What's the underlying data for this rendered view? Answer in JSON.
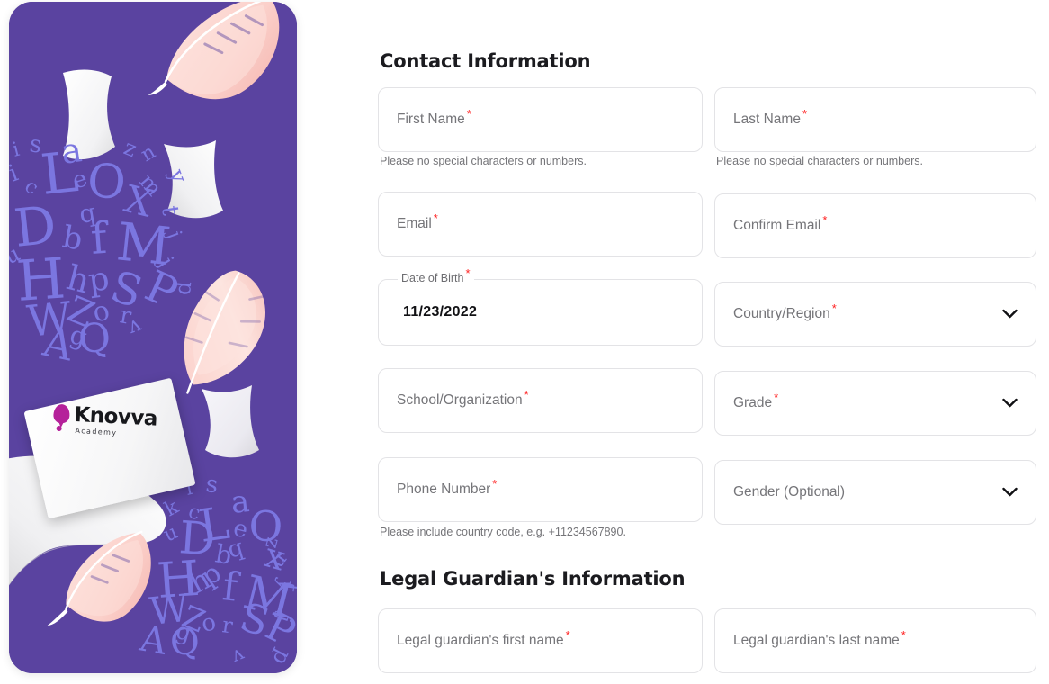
{
  "illustration": {
    "panel_color": "#5a43a0",
    "letters_color": "#7b76e0",
    "feather_color": "#fbd2cd",
    "paper_color": "#ffffff",
    "logo": {
      "name": "Knovva",
      "subtitle": "Academy",
      "mark": "balloon-bulb-icon",
      "mark_color": "#b5219a"
    },
    "scattered_letters": [
      "i",
      "s",
      "a",
      "z",
      "n",
      "y",
      "L",
      "e",
      "O",
      "x",
      "m",
      "t",
      "j",
      "c",
      "q",
      "X",
      "D",
      "b",
      "f",
      "M",
      "j",
      "u",
      "h",
      "p",
      "S",
      "P",
      "W",
      "z",
      "o",
      "r",
      "v",
      "g",
      "A",
      "Q",
      "k",
      "i",
      "s",
      "a",
      "L",
      "e",
      "O",
      "x",
      "n",
      "y",
      "D",
      "b",
      "f",
      "M",
      "H",
      "p",
      "S",
      "P",
      "t",
      "A",
      "Q",
      "r",
      "v",
      "p"
    ]
  },
  "form": {
    "sections": [
      {
        "title": "Contact Information",
        "rows": [
          {
            "left": {
              "label": "First Name",
              "required": true,
              "type": "text",
              "helper": "Please no special characters or numbers."
            },
            "right": {
              "label": "Last Name",
              "required": true,
              "type": "text",
              "helper": "Please no special characters or numbers."
            }
          },
          {
            "left": {
              "label": "Email",
              "required": true,
              "type": "text",
              "helper": ""
            },
            "right": {
              "label": "Confirm Email",
              "required": true,
              "type": "text",
              "helper": ""
            }
          },
          {
            "left": {
              "label": "Date of Birth",
              "required": true,
              "type": "date-filled",
              "value": "11/23/2022",
              "helper": ""
            },
            "right": {
              "label": "Country/Region",
              "required": true,
              "type": "select",
              "value": "",
              "helper": ""
            }
          },
          {
            "left": {
              "label": "School/Organization",
              "required": true,
              "type": "text",
              "helper": ""
            },
            "right": {
              "label": "Grade",
              "required": true,
              "type": "select",
              "value": "",
              "helper": ""
            }
          },
          {
            "left": {
              "label": "Phone Number",
              "required": true,
              "type": "text",
              "helper": "Please include country code, e.g. +11234567890."
            },
            "right": {
              "label": "Gender (Optional)",
              "required": false,
              "type": "select",
              "value": "",
              "helper": ""
            }
          }
        ]
      },
      {
        "title": "Legal Guardian's Information",
        "rows": [
          {
            "left": {
              "label": "Legal guardian's first name",
              "required": true,
              "type": "text",
              "helper": ""
            },
            "right": {
              "label": "Legal guardian's last name",
              "required": true,
              "type": "text",
              "helper": ""
            }
          }
        ]
      }
    ],
    "required_marker": "*",
    "required_color": "#ff1f1f",
    "select_icon": "chevron-down-icon"
  }
}
